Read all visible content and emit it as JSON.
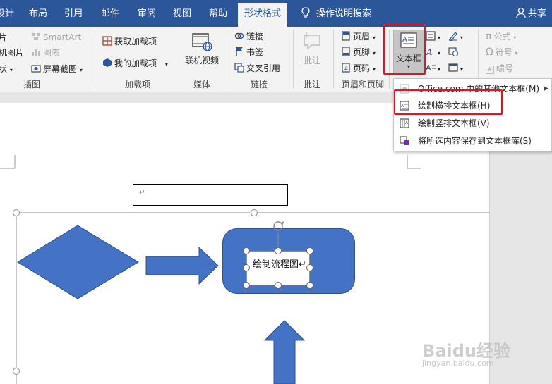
{
  "tabs": {
    "design": "设计",
    "layout": "布局",
    "references": "引用",
    "mailings": "邮件",
    "review": "审阅",
    "view": "视图",
    "help": "帮助",
    "shape_format": "形状格式",
    "tell_me": "操作说明搜索",
    "share": "共享"
  },
  "ribbon": {
    "illustrations": {
      "pictures": "片",
      "online_pictures": "机图片",
      "shapes": "状",
      "smartart": "SmartArt",
      "chart": "图表",
      "screenshot": "屏幕截图",
      "label": "插图"
    },
    "addins": {
      "get": "获取加载项",
      "my": "我的加载项",
      "label": "加载项"
    },
    "media": {
      "online_video": "联机视频",
      "label": "媒体"
    },
    "links": {
      "link": "链接",
      "bookmark": "书签",
      "cross_ref": "交叉引用",
      "label": "链接"
    },
    "comments": {
      "comment": "批注",
      "label": "批注"
    },
    "header_footer": {
      "header": "页眉",
      "footer": "页脚",
      "page_number": "页码",
      "label": "页眉和页脚"
    },
    "text": {
      "textbox": "文本框"
    },
    "symbols": {
      "equation": "公式",
      "symbol": "符号",
      "number": "编号"
    }
  },
  "dropdown": {
    "more": "Office.com 中的其他文本框(M)",
    "draw_horizontal": "绘制横排文本框(H)",
    "draw_vertical": "绘制竖排文本框(V)",
    "save_selection": "将所选内容保存到文本框库(S)"
  },
  "document": {
    "flow_box_text": "绘制流程图↵",
    "empty_para": "↵"
  },
  "watermark": {
    "brand": "Baidu经验",
    "url": "jingyan.baidu.com"
  },
  "colors": {
    "ribbon_blue": "#2b579a",
    "shape_fill": "#4472c4",
    "shape_stroke": "#2f528f",
    "highlight_red": "#e81123"
  }
}
